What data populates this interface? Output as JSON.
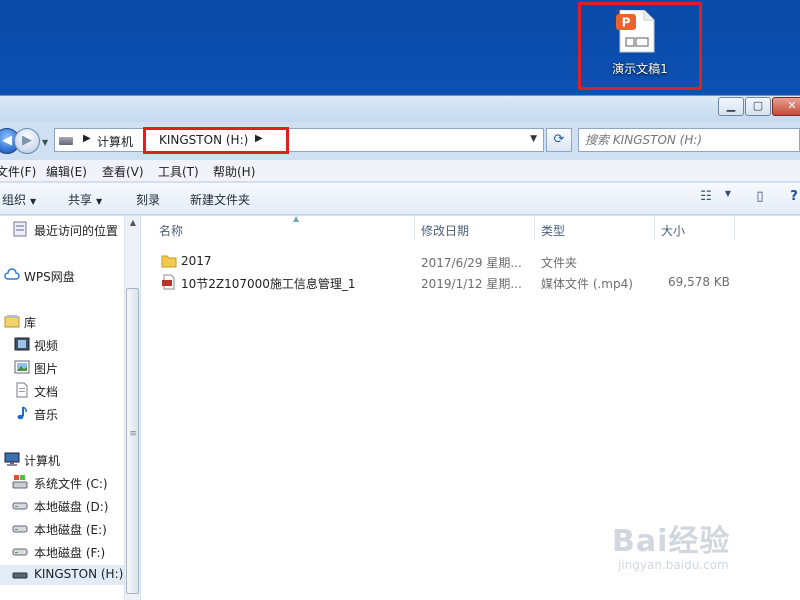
{
  "desktop": {
    "icon_label": "演示文稿1",
    "accent": "#e02020"
  },
  "window": {
    "nav": {
      "address": {
        "crumbs": [
          "计算机",
          "KINGSTON (H:)"
        ]
      },
      "search": {
        "placeholder": "搜索 KINGSTON (H:)"
      }
    },
    "menu": [
      "文件(F)",
      "编辑(E)",
      "查看(V)",
      "工具(T)",
      "帮助(H)"
    ],
    "toolbar": {
      "organize": "组织",
      "share": "共享",
      "burn": "刻录",
      "new_folder": "新建文件夹"
    },
    "sidebar": {
      "items": [
        {
          "label": "最近访问的位置",
          "icon": "recent-icon"
        },
        {
          "label": "WPS网盘",
          "icon": "cloud-icon"
        },
        {
          "label": "库",
          "icon": "library-icon"
        },
        {
          "label": "视频",
          "icon": "video-icon"
        },
        {
          "label": "图片",
          "icon": "picture-icon"
        },
        {
          "label": "文档",
          "icon": "document-icon"
        },
        {
          "label": "音乐",
          "icon": "music-icon"
        },
        {
          "label": "计算机",
          "icon": "computer-icon"
        },
        {
          "label": "系统文件 (C:)",
          "icon": "system-drive-icon"
        },
        {
          "label": "本地磁盘 (D:)",
          "icon": "drive-icon"
        },
        {
          "label": "本地磁盘 (E:)",
          "icon": "drive-icon"
        },
        {
          "label": "本地磁盘 (F:)",
          "icon": "drive-icon"
        },
        {
          "label": "KINGSTON (H:)",
          "icon": "usb-drive-icon"
        }
      ]
    },
    "columns": [
      "名称",
      "修改日期",
      "类型",
      "大小"
    ],
    "files": [
      {
        "name": "2017",
        "modified": "2017/6/29 星期...",
        "type": "文件夹",
        "size": "",
        "icon": "folder-icon"
      },
      {
        "name": "10节2Z107000施工信息管理_1",
        "modified": "2019/1/12 星期...",
        "type": "媒体文件 (.mp4)",
        "size": "69,578 KB",
        "icon": "video-file-icon"
      }
    ]
  },
  "watermark": {
    "brand": "Bai经验",
    "url": "jingyan.baidu.com"
  }
}
